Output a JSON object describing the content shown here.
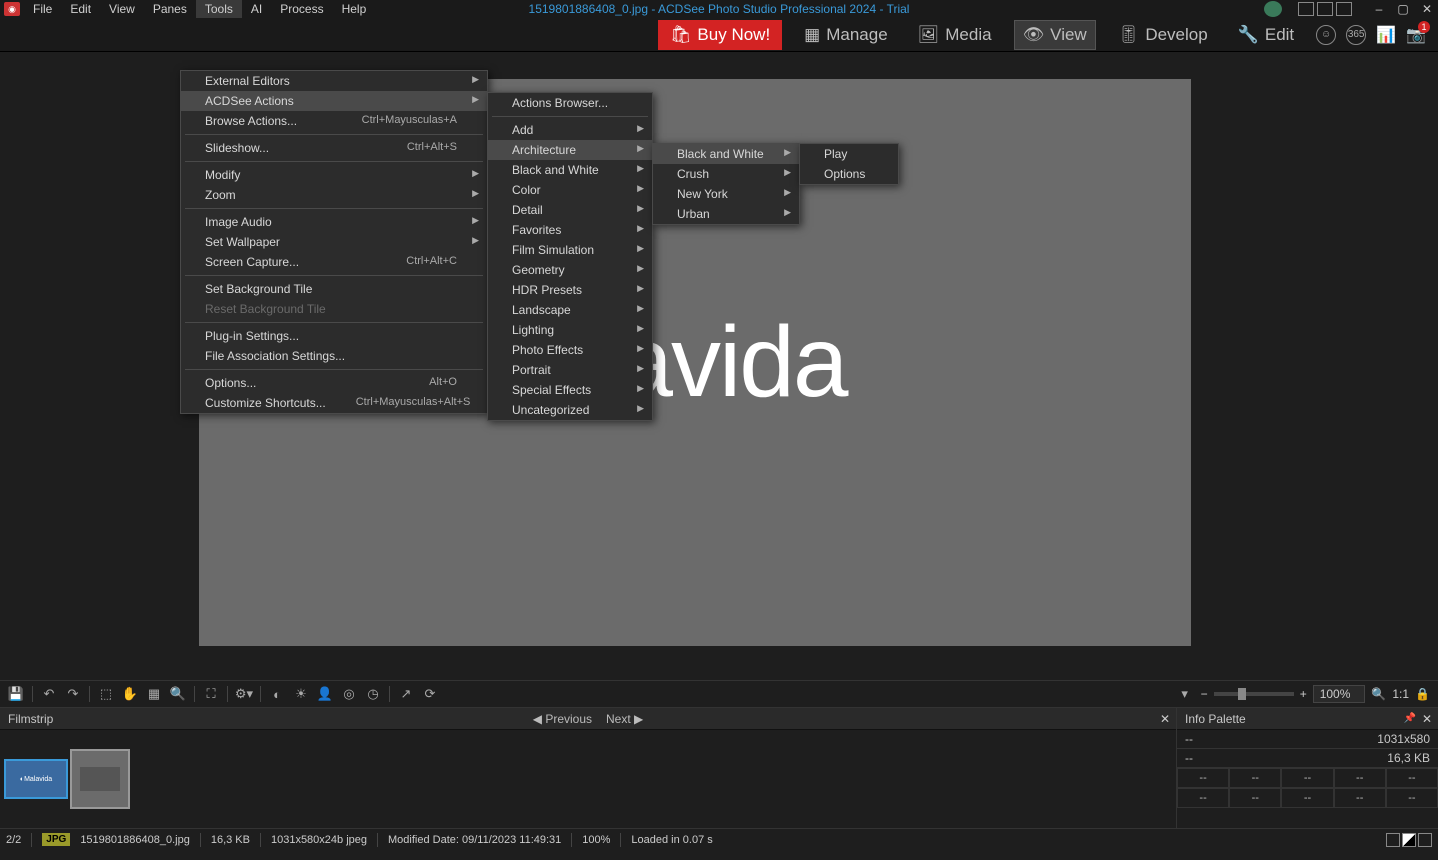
{
  "title": "1519801886408_0.jpg - ACDSee Photo Studio Professional 2024 - Trial",
  "menubar": [
    "File",
    "Edit",
    "View",
    "Panes",
    "Tools",
    "AI",
    "Process",
    "Help"
  ],
  "modebar": {
    "buy": "Buy Now!",
    "manage": "Manage",
    "media": "Media",
    "view": "View",
    "develop": "Develop",
    "edit": "Edit"
  },
  "tools_menu": [
    {
      "label": "External Editors",
      "arrow": true
    },
    {
      "label": "ACDSee Actions",
      "arrow": true,
      "highlight": true
    },
    {
      "label": "Browse Actions...",
      "shortcut": "Ctrl+Mayusculas+A"
    },
    {
      "sep": true
    },
    {
      "label": "Slideshow...",
      "shortcut": "Ctrl+Alt+S"
    },
    {
      "sep": true
    },
    {
      "label": "Modify",
      "arrow": true
    },
    {
      "label": "Zoom",
      "arrow": true
    },
    {
      "sep": true
    },
    {
      "label": "Image Audio",
      "arrow": true
    },
    {
      "label": "Set Wallpaper",
      "arrow": true
    },
    {
      "label": "Screen Capture...",
      "shortcut": "Ctrl+Alt+C"
    },
    {
      "sep": true
    },
    {
      "label": "Set Background Tile"
    },
    {
      "label": "Reset Background Tile",
      "disabled": true
    },
    {
      "sep": true
    },
    {
      "label": "Plug-in Settings..."
    },
    {
      "label": "File Association Settings..."
    },
    {
      "sep": true
    },
    {
      "label": "Options...",
      "shortcut": "Alt+O"
    },
    {
      "label": "Customize Shortcuts...",
      "shortcut": "Ctrl+Mayusculas+Alt+S"
    }
  ],
  "actions_menu": [
    {
      "label": "Actions Browser..."
    },
    {
      "sep": true
    },
    {
      "label": "Add",
      "arrow": true
    },
    {
      "label": "Architecture",
      "arrow": true,
      "highlight": true
    },
    {
      "label": "Black and White",
      "arrow": true
    },
    {
      "label": "Color",
      "arrow": true
    },
    {
      "label": "Detail",
      "arrow": true
    },
    {
      "label": "Favorites",
      "arrow": true
    },
    {
      "label": "Film Simulation",
      "arrow": true
    },
    {
      "label": "Geometry",
      "arrow": true
    },
    {
      "label": "HDR Presets",
      "arrow": true
    },
    {
      "label": "Landscape",
      "arrow": true
    },
    {
      "label": "Lighting",
      "arrow": true
    },
    {
      "label": "Photo Effects",
      "arrow": true
    },
    {
      "label": "Portrait",
      "arrow": true
    },
    {
      "label": "Special Effects",
      "arrow": true
    },
    {
      "label": "Uncategorized",
      "arrow": true
    }
  ],
  "arch_menu": [
    {
      "label": "Black and White",
      "arrow": true,
      "highlight": true
    },
    {
      "label": "Crush",
      "arrow": true
    },
    {
      "label": "New York",
      "arrow": true
    },
    {
      "label": "Urban",
      "arrow": true
    }
  ],
  "bw_menu": [
    {
      "label": "Play"
    },
    {
      "label": "Options"
    }
  ],
  "watermark": "alavida",
  "filmstrip": {
    "title": "Filmstrip",
    "prev": "Previous",
    "next": "Next"
  },
  "info_palette": {
    "title": "Info Palette",
    "dims": "1031x580",
    "size": "16,3 KB",
    "dash": "--"
  },
  "zoom_pct": "100%",
  "status": {
    "index": "2/2",
    "fmt": "JPG",
    "fname": "1519801886408_0.jpg",
    "fsize": "16,3 KB",
    "res": "1031x580x24b jpeg",
    "mod": "Modified Date: 09/11/2023 11:49:31",
    "zoom": "100%",
    "load": "Loaded in 0.07 s"
  }
}
